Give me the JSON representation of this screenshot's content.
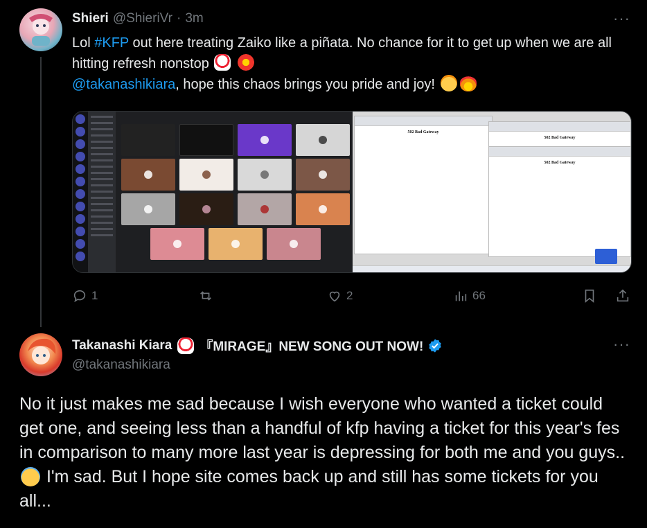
{
  "tweet1": {
    "author_name": "Shieri",
    "handle": "@ShieriVr",
    "separator": "·",
    "time": "3m",
    "more": "···",
    "text_part1": "Lol ",
    "hashtag": "#KFP",
    "text_part2": " out here treating Zaiko like a piñata. No chance for it to get up when we are all hitting refresh nonstop ",
    "mention": "@takanashikiara",
    "text_part3": ", hope this chaos brings you pride and joy! ",
    "emojis": [
      "chicken",
      "collision",
      "face-with-tears-of-joy",
      "fire"
    ],
    "media": {
      "left_window": "discord-stream-grid",
      "right_window": "browser-windows",
      "error_title": "502 Bad Gateway",
      "tile_colors": [
        "#222222",
        "#111111",
        "#6a38c9",
        "#d6d6d6",
        "#7a4a32",
        "#f2ece7",
        "#d9d9d9",
        "#7c5747",
        "#a6a6a6",
        "#2a1d14",
        "#b3a6a6",
        "#d9834f",
        "#dd8b94",
        "#e8b26e",
        "#c9868e"
      ]
    },
    "actions": {
      "reply_count": "1",
      "retweet_count": "",
      "like_count": "2",
      "views_count": "66"
    }
  },
  "tweet2": {
    "author_name": "Takanashi Kiara",
    "name_suffix": "『MIRAGE』NEW SONG OUT NOW!",
    "verified": true,
    "handle": "@takanashikiara",
    "more": "···",
    "text_part1": "No it just makes me sad because I wish everyone who wanted a ticket could get one, and seeing less than a handful of kfp having a ticket for this year's fes in comparison to many more last year is depressing for both me and you guys..",
    "text_part2": " I'm sad. But I hope site comes back up and still has some tickets for you all...",
    "emojis": [
      "chicken",
      "downcast-face-with-sweat"
    ]
  },
  "colors": {
    "background": "#000000",
    "text": "#e7e9ea",
    "muted": "#71767b",
    "link": "#1d9bf0",
    "divider": "#333639"
  }
}
